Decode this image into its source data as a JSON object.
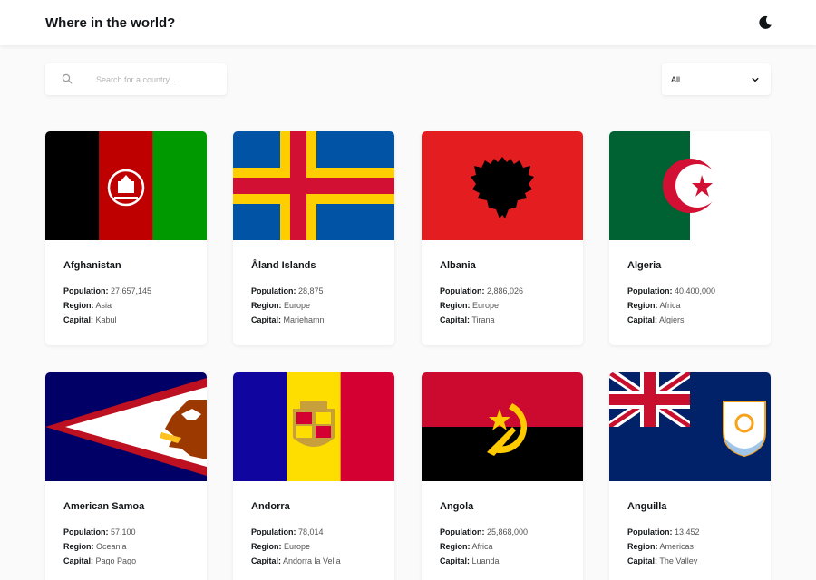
{
  "header": {
    "title": "Where in the world?",
    "theme_icon": "moon-icon"
  },
  "search": {
    "placeholder": "Search for a country...",
    "value": "",
    "icon": "search-icon"
  },
  "filter": {
    "selected": "All",
    "icon": "chevron-down-icon"
  },
  "labels": {
    "population": "Population:",
    "region": "Region:",
    "capital": "Capital:"
  },
  "colors": {
    "background": "#fafafa",
    "card": "#ffffff",
    "text": "#111517"
  },
  "countries": [
    {
      "name": "Afghanistan",
      "population": "27,657,145",
      "region": "Asia",
      "capital": "Kabul",
      "flag": "afghanistan-flag"
    },
    {
      "name": "Åland Islands",
      "population": "28,875",
      "region": "Europe",
      "capital": "Mariehamn",
      "flag": "aland-islands-flag"
    },
    {
      "name": "Albania",
      "population": "2,886,026",
      "region": "Europe",
      "capital": "Tirana",
      "flag": "albania-flag"
    },
    {
      "name": "Algeria",
      "population": "40,400,000",
      "region": "Africa",
      "capital": "Algiers",
      "flag": "algeria-flag"
    },
    {
      "name": "American Samoa",
      "population": "57,100",
      "region": "Oceania",
      "capital": "Pago Pago",
      "flag": "american-samoa-flag"
    },
    {
      "name": "Andorra",
      "population": "78,014",
      "region": "Europe",
      "capital": "Andorra la Vella",
      "flag": "andorra-flag"
    },
    {
      "name": "Angola",
      "population": "25,868,000",
      "region": "Africa",
      "capital": "Luanda",
      "flag": "angola-flag"
    },
    {
      "name": "Anguilla",
      "population": "13,452",
      "region": "Americas",
      "capital": "The Valley",
      "flag": "anguilla-flag"
    }
  ]
}
